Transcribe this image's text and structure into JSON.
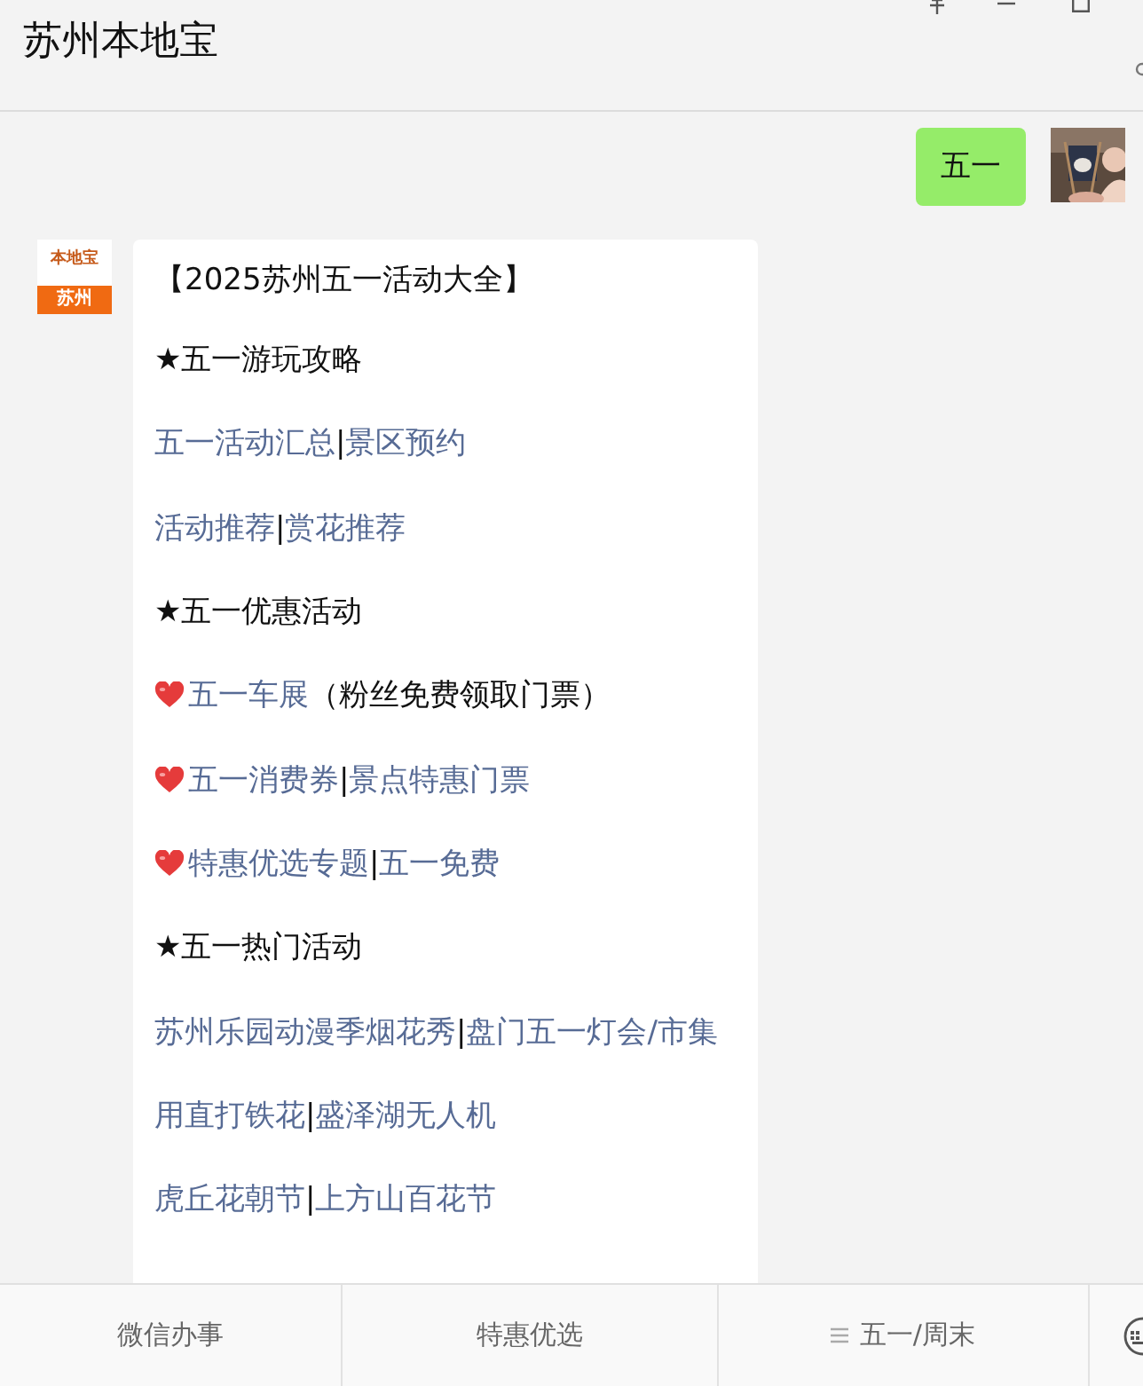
{
  "window": {
    "title": "苏州本地宝"
  },
  "sent_message": {
    "text": "五一"
  },
  "received_message": {
    "avatar_brand": "本地宝",
    "avatar_city": "苏州",
    "lines": [
      {
        "kind": "text",
        "parts": [
          {
            "text": "【2025苏州五一活动大全】",
            "link": false
          }
        ]
      },
      {
        "kind": "text",
        "parts": [
          {
            "text": "★五一游玩攻略",
            "link": false
          }
        ]
      },
      {
        "kind": "text",
        "parts": [
          {
            "text": "五一活动汇总",
            "link": true
          },
          {
            "text": "|",
            "link": false
          },
          {
            "text": "景区预约",
            "link": true
          }
        ]
      },
      {
        "kind": "text",
        "parts": [
          {
            "text": "活动推荐",
            "link": true
          },
          {
            "text": "|",
            "link": false
          },
          {
            "text": "赏花推荐",
            "link": true
          }
        ]
      },
      {
        "kind": "text",
        "parts": [
          {
            "text": "★五一优惠活动",
            "link": false
          }
        ]
      },
      {
        "kind": "heart",
        "parts": [
          {
            "text": "五一车展",
            "link": true
          },
          {
            "text": "（粉丝免费领取门票）",
            "link": false
          }
        ]
      },
      {
        "kind": "heart",
        "parts": [
          {
            "text": "五一消费券",
            "link": true
          },
          {
            "text": "|",
            "link": false
          },
          {
            "text": "景点特惠门票",
            "link": true
          }
        ]
      },
      {
        "kind": "heart",
        "parts": [
          {
            "text": "特惠优选专题",
            "link": true
          },
          {
            "text": "|",
            "link": false
          },
          {
            "text": "五一免费",
            "link": true
          }
        ]
      },
      {
        "kind": "text",
        "parts": [
          {
            "text": "★五一热门活动",
            "link": false
          }
        ]
      },
      {
        "kind": "text",
        "parts": [
          {
            "text": "苏州乐园动漫季烟花秀",
            "link": true
          },
          {
            "text": "|",
            "link": false
          },
          {
            "text": "盘门五一灯会/市集",
            "link": true
          }
        ]
      },
      {
        "kind": "text",
        "parts": [
          {
            "text": "用直打铁花",
            "link": true
          },
          {
            "text": "|",
            "link": false
          },
          {
            "text": "盛泽湖无人机",
            "link": true
          }
        ]
      },
      {
        "kind": "text",
        "parts": [
          {
            "text": "虎丘花朝节",
            "link": true
          },
          {
            "text": "|",
            "link": false
          },
          {
            "text": "上方山百花节",
            "link": true
          }
        ]
      }
    ]
  },
  "menu": [
    {
      "label": "微信办事",
      "submenu": false
    },
    {
      "label": "特惠优选",
      "submenu": false
    },
    {
      "label": "五一/周末",
      "submenu": true
    }
  ]
}
